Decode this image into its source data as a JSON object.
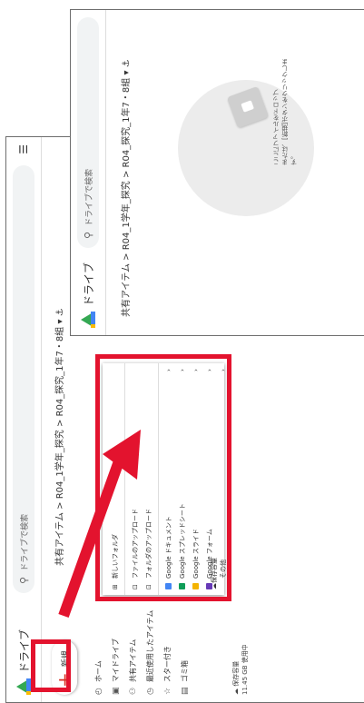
{
  "drive": {
    "app_name": "ドライブ",
    "search_placeholder": "ドライブで検索",
    "breadcrumb": "共有アイテム > R04_1学年_探究 > R04_探究_1年7・8組 ▾ ⚓",
    "new_button_label": "新規",
    "sidebar": [
      {
        "icon": "home-icon",
        "label": "ホーム"
      },
      {
        "icon": "my-drive-icon",
        "label": "マイドライブ"
      },
      {
        "icon": "shared-icon",
        "label": "共有アイテム"
      },
      {
        "icon": "recent-icon",
        "label": "最近使用したアイテム"
      },
      {
        "icon": "star-icon",
        "label": "スター付き"
      },
      {
        "icon": "trash-icon",
        "label": "ゴミ箱"
      }
    ],
    "storage_label": "保存容量",
    "storage_used": "11.45 GB 使用中"
  },
  "new_menu": {
    "items": [
      {
        "icon": "folder-icon",
        "label": "新しいフォルダ"
      },
      {
        "icon": "file-upload-icon",
        "label": "ファイルのアップロード"
      },
      {
        "icon": "folder-upload-icon",
        "label": "フォルダのアップロード"
      },
      {
        "icon": "docs-icon",
        "label": "Google ドキュメント",
        "color": "#4285f4"
      },
      {
        "icon": "sheets-icon",
        "label": "Google スプレッドシート",
        "color": "#0f9d58"
      },
      {
        "icon": "slides-icon",
        "label": "Google スライド",
        "color": "#f4b400"
      },
      {
        "icon": "forms-icon",
        "label": "Google フォーム",
        "color": "#673ab7"
      },
      {
        "label": "その他"
      }
    ],
    "storage_label": "保存容量"
  },
  "dropzone": {
    "line1": "ここにファイルをドロップ",
    "line2": "または、[新規]ボタンをクリックします。"
  },
  "colors": {
    "highlight": "#e3132e"
  }
}
